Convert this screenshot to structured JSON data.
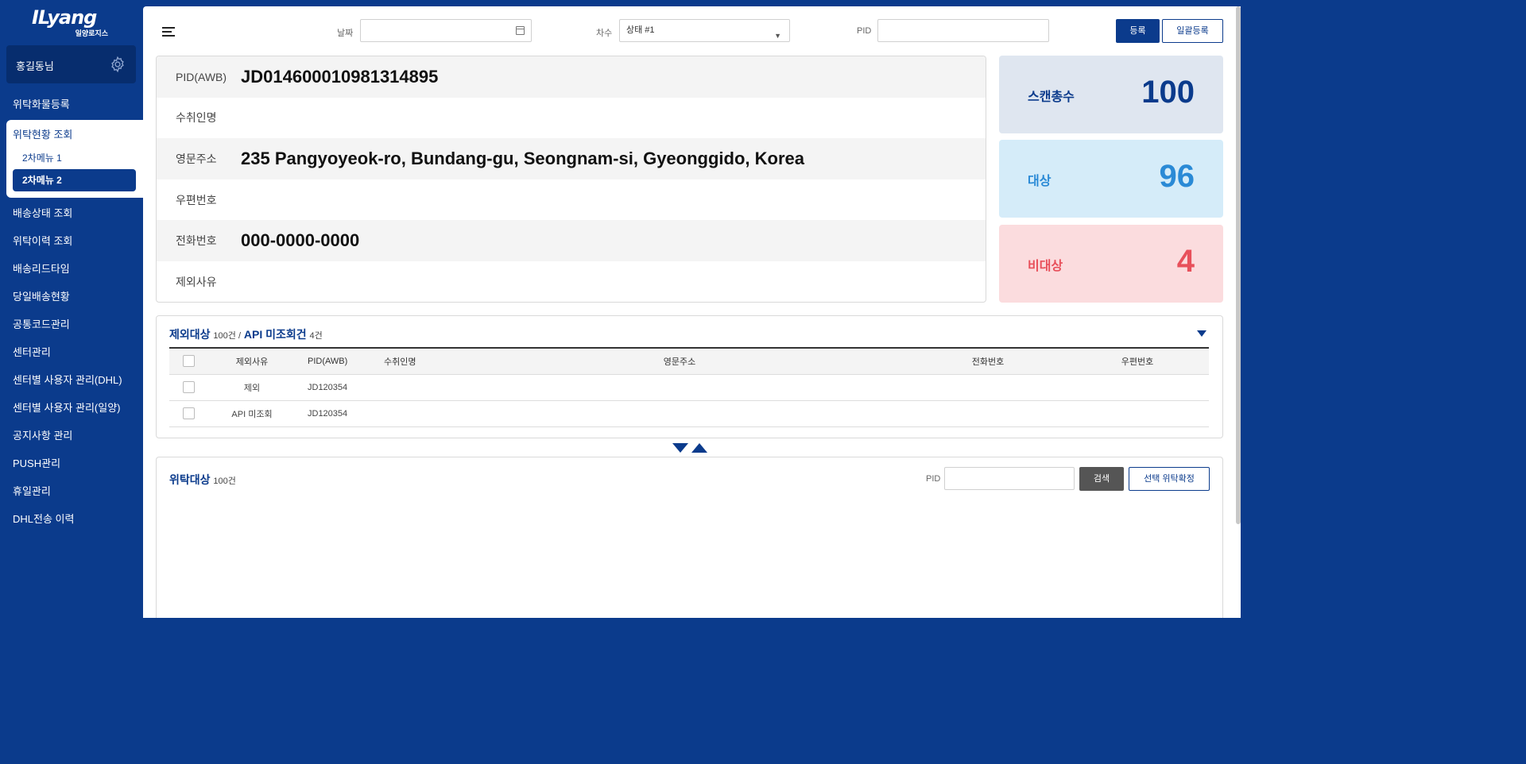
{
  "brand": {
    "logo": "ILyang",
    "subtitle": "일양로지스"
  },
  "user": {
    "name": "홍길동님"
  },
  "icons": {
    "settings": "gear-icon",
    "menu": "hamburger-icon",
    "calendar": "calendar-icon"
  },
  "sidebar": {
    "items": [
      {
        "label": "위탁화물등록"
      },
      {
        "label": "위탁현황 조회",
        "sub": [
          "2차메뉴 1",
          "2차메뉴 2"
        ],
        "active_sub": "2차메뉴 2"
      },
      {
        "label": "배송상태 조회"
      },
      {
        "label": "위탁이력 조회"
      },
      {
        "label": "배송리드타임"
      },
      {
        "label": "당일배송현황"
      },
      {
        "label": "공통코드관리"
      },
      {
        "label": "센터관리"
      },
      {
        "label": "센터별 사용자 관리(DHL)"
      },
      {
        "label": "센터별 사용자 관리(일양)"
      },
      {
        "label": "공지사항 관리"
      },
      {
        "label": "PUSH관리"
      },
      {
        "label": "휴일관리"
      },
      {
        "label": "DHL전송 이력"
      }
    ]
  },
  "toolbar": {
    "date_label": "날짜",
    "date_value": "",
    "round_label": "차수",
    "round_value": "상태 #1",
    "pid_label": "PID",
    "pid_value": "",
    "register_label": "등록",
    "bulk_register_label": "일괄등록"
  },
  "info": {
    "pid_label": "PID(AWB)",
    "pid_value": "JD014600010981314895",
    "recipient_label": "수취인명",
    "recipient_value": "",
    "address_label": "영문주소",
    "address_value": "235 Pangyoyeok-ro, Bundang-gu, Seongnam-si, Gyeonggido, Korea",
    "zip_label": "우편번호",
    "zip_value": "",
    "phone_label": "전화번호",
    "phone_value": "000-0000-0000",
    "reason_label": "제외사유",
    "reason_value": ""
  },
  "stats": {
    "scan_label": "스캔총수",
    "scan_value": "100",
    "target_label": "대상",
    "target_value": "96",
    "nontarget_label": "비대상",
    "nontarget_value": "4",
    "colors": {
      "scan_bg": "#dfe6f0",
      "scan_fg": "#0b3b8c",
      "target_bg": "#d5ecf9",
      "target_fg": "#2a8ad6",
      "nontarget_bg": "#fbdcde",
      "nontarget_fg": "#e8505b"
    }
  },
  "exclusion": {
    "title": "제외대상",
    "count": "100건 /",
    "api_title": "API 미조회건",
    "api_count": "4건",
    "columns": [
      "제외사유",
      "PID(AWB)",
      "수취인명",
      "영문주소",
      "전화번호",
      "우편번호"
    ],
    "rows": [
      {
        "reason": "제외",
        "pid": "JD120354",
        "recipient": "",
        "address": "",
        "phone": "",
        "zip": ""
      },
      {
        "reason": "API 미조회",
        "pid": "JD120354",
        "recipient": "",
        "address": "",
        "phone": "",
        "zip": ""
      }
    ]
  },
  "consign": {
    "title": "위탁대상",
    "count": "100건",
    "pid_label": "PID",
    "pid_value": "",
    "search_label": "검색",
    "confirm_label": "선택 위탁확정"
  }
}
